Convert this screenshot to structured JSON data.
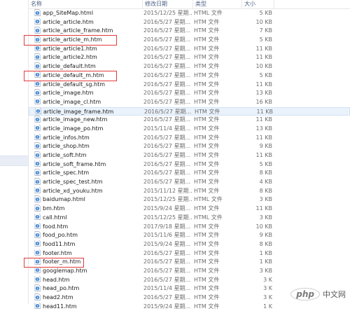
{
  "header": {
    "name": "名称",
    "date": "修改日期",
    "type": "类型",
    "size": "大小"
  },
  "files": [
    {
      "name": "app_SiteMap.html",
      "date": "2015/12/25 星期...",
      "type": "HTML 文件",
      "size": "5 KB"
    },
    {
      "name": "article_article.htm",
      "date": "2016/5/27 星期...",
      "type": "HTM 文件",
      "size": "10 KB"
    },
    {
      "name": "article_article_frame.htm",
      "date": "2016/5/27 星期...",
      "type": "HTM 文件",
      "size": "7 KB"
    },
    {
      "name": "article_article_m.htm",
      "date": "2016/5/27 星期...",
      "type": "HTM 文件",
      "size": "5 KB"
    },
    {
      "name": "article_article1.htm",
      "date": "2016/5/27 星期...",
      "type": "HTM 文件",
      "size": "11 KB"
    },
    {
      "name": "article_article2.htm",
      "date": "2016/5/27 星期...",
      "type": "HTM 文件",
      "size": "11 KB"
    },
    {
      "name": "article_default.htm",
      "date": "2016/5/27 星期...",
      "type": "HTM 文件",
      "size": "10 KB"
    },
    {
      "name": "article_default_m.htm",
      "date": "2016/5/27 星期...",
      "type": "HTM 文件",
      "size": "5 KB"
    },
    {
      "name": "article_default_sg.htm",
      "date": "2016/5/27 星期...",
      "type": "HTM 文件",
      "size": "11 KB"
    },
    {
      "name": "article_image.htm",
      "date": "2016/5/27 星期...",
      "type": "HTM 文件",
      "size": "13 KB"
    },
    {
      "name": "article_image_cl.htm",
      "date": "2016/5/27 星期...",
      "type": "HTM 文件",
      "size": "16 KB"
    },
    {
      "name": "article_image_frame.htm",
      "date": "2016/5/27 星期...",
      "type": "HTM 文件",
      "size": "11 KB"
    },
    {
      "name": "article_image_new.htm",
      "date": "2016/5/27 星期...",
      "type": "HTM 文件",
      "size": "11 KB"
    },
    {
      "name": "article_image_po.htm",
      "date": "2015/11/4 星期...",
      "type": "HTM 文件",
      "size": "13 KB"
    },
    {
      "name": "article_infos.htm",
      "date": "2016/5/27 星期...",
      "type": "HTM 文件",
      "size": "11 KB"
    },
    {
      "name": "article_shop.htm",
      "date": "2016/5/27 星期...",
      "type": "HTM 文件",
      "size": "9 KB"
    },
    {
      "name": "article_soft.htm",
      "date": "2016/5/27 星期...",
      "type": "HTM 文件",
      "size": "11 KB"
    },
    {
      "name": "article_soft_frame.htm",
      "date": "2016/5/27 星期...",
      "type": "HTM 文件",
      "size": "5 KB"
    },
    {
      "name": "article_spec.htm",
      "date": "2016/5/27 星期...",
      "type": "HTM 文件",
      "size": "8 KB"
    },
    {
      "name": "article_spec_test.htm",
      "date": "2016/5/27 星期...",
      "type": "HTM 文件",
      "size": "4 KB"
    },
    {
      "name": "article_xd_youku.htm",
      "date": "2015/11/12 星期...",
      "type": "HTM 文件",
      "size": "8 KB"
    },
    {
      "name": "baidumap.html",
      "date": "2015/12/25 星期...",
      "type": "HTML 文件",
      "size": "3 KB"
    },
    {
      "name": "bm.htm",
      "date": "2015/9/24 星期...",
      "type": "HTM 文件",
      "size": "11 KB"
    },
    {
      "name": "call.html",
      "date": "2015/12/25 星期...",
      "type": "HTML 文件",
      "size": "3 KB"
    },
    {
      "name": "food.htm",
      "date": "2017/9/18 星期...",
      "type": "HTM 文件",
      "size": "10 KB"
    },
    {
      "name": "food_po.htm",
      "date": "2015/11/6 星期...",
      "type": "HTM 文件",
      "size": "9 KB"
    },
    {
      "name": "food11.htm",
      "date": "2015/9/24 星期...",
      "type": "HTM 文件",
      "size": "8 KB"
    },
    {
      "name": "footer.htm",
      "date": "2016/5/27 星期...",
      "type": "HTM 文件",
      "size": "1 KB"
    },
    {
      "name": "footer_m.htm",
      "date": "2016/5/27 星期...",
      "type": "HTM 文件",
      "size": "1 KB"
    },
    {
      "name": "googlemap.htm",
      "date": "2016/5/27 星期...",
      "type": "HTM 文件",
      "size": "3 KB"
    },
    {
      "name": "head.htm",
      "date": "2016/5/27 星期...",
      "type": "HTM 文件",
      "size": "3 K"
    },
    {
      "name": "head_po.htm",
      "date": "2015/11/4 星期...",
      "type": "HTM 文件",
      "size": "3 K"
    },
    {
      "name": "head2.htm",
      "date": "2016/5/27 星期...",
      "type": "HTM 文件",
      "size": "3 K"
    },
    {
      "name": "head11.htm",
      "date": "2015/9/24 星期...",
      "type": "HTM 文件",
      "size": "1 K"
    }
  ],
  "hover_row": 11,
  "highlighted_rows": [
    3,
    7,
    28
  ],
  "watermark": {
    "logo": "php",
    "text": "中文网"
  },
  "colors": {
    "highlight": "#e23b3b",
    "hover": "#eaf2fb",
    "header_text": "#4d6185"
  }
}
